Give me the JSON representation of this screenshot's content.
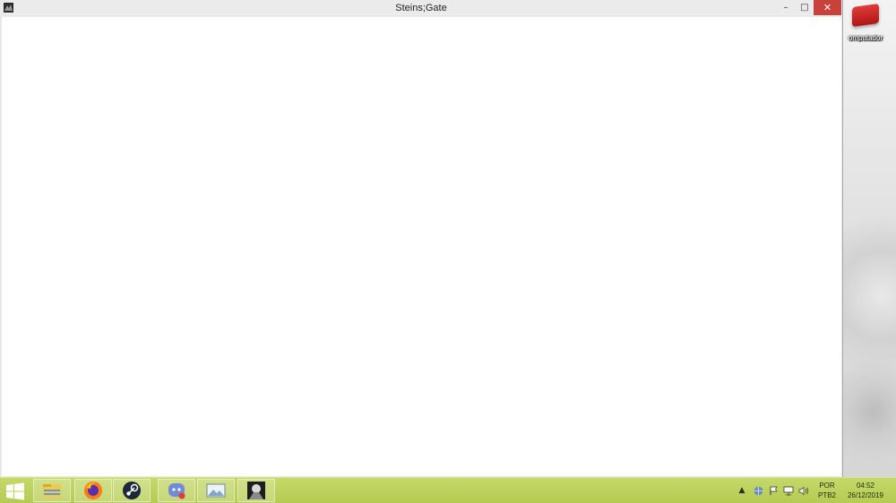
{
  "window": {
    "title": "Steins;Gate",
    "minimize_glyph": "–",
    "maximize_glyph": "□",
    "close_glyph": "✕"
  },
  "desktop": {
    "icon_label": "omputador",
    "icon": "computer-icon"
  },
  "taskbar": {
    "start_icon": "windows-logo-icon",
    "pinned": [
      {
        "name": "file-explorer-icon",
        "active": true
      },
      {
        "name": "firefox-icon",
        "active": true
      },
      {
        "name": "steam-icon",
        "active": true
      },
      {
        "name": "discord-icon",
        "active": true
      },
      {
        "name": "photo-viewer-icon",
        "active": true
      },
      {
        "name": "steins-gate-app-icon",
        "active": true
      }
    ],
    "tray": {
      "icons": [
        "show-hidden-icons-chevron",
        "network-globe-icon",
        "action-center-flag-icon",
        "network-icon",
        "volume-icon"
      ],
      "language_line1": "POR",
      "language_line2": "PTB2",
      "time": "04:52",
      "date": "26/12/2019"
    }
  },
  "colors": {
    "taskbar": "#b8cd56",
    "close_button": "#c7423a",
    "titlebar": "#ebebeb",
    "client_area": "#ffffff"
  }
}
